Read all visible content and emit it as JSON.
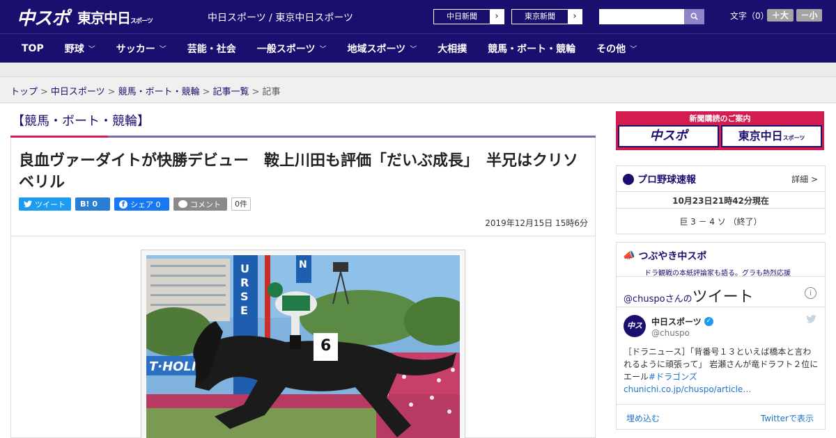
{
  "header": {
    "logo_main": "中スポ",
    "logo_tokyo": "東京中日",
    "logo_tokyo_small": "スポーツ",
    "site_title": "中日スポーツ / 東京中日スポーツ",
    "ext_links": [
      {
        "label": "中日新聞"
      },
      {
        "label": "東京新聞"
      }
    ],
    "font_label": "文字（0）",
    "font_up": "＋大",
    "font_down": "－小"
  },
  "nav": {
    "items": [
      {
        "label": "TOP",
        "chevron": false
      },
      {
        "label": "野球",
        "chevron": true
      },
      {
        "label": "サッカー",
        "chevron": true
      },
      {
        "label": "芸能・社会",
        "chevron": false
      },
      {
        "label": "一般スポーツ",
        "chevron": true
      },
      {
        "label": "地域スポーツ",
        "chevron": true
      },
      {
        "label": "大相撲",
        "chevron": false
      },
      {
        "label": "競馬・ボート・競輪",
        "chevron": false
      },
      {
        "label": "その他",
        "chevron": true
      }
    ]
  },
  "breadcrumb": {
    "items": [
      "トップ",
      "中日スポーツ",
      "競馬・ボート・競輪",
      "記事一覧"
    ],
    "current": "記事"
  },
  "article": {
    "section": "【競馬・ボート・競輪】",
    "headline": "良血ヴァーダイトが快勝デビュー　鞍上川田も評価「だいぶ成長」　半兄はクリソベリル",
    "share": {
      "tweet": "ツイート",
      "hatena": "0",
      "facebook": "シェア 0",
      "comment": "コメント",
      "comment_count": "0件"
    },
    "date": "2019年12月15日 15時6分"
  },
  "sidebar": {
    "subscribe": {
      "head": "新聞購読のご案内",
      "logo_a": "中スポ",
      "logo_b": "東京中日",
      "logo_b_small": "スポーツ"
    },
    "baseball": {
      "title": "プロ野球速報",
      "detail": "詳細 >",
      "timestamp": "10月23日21時42分現在",
      "score": "巨 3 － 4 ソ （終了）"
    },
    "tweets": {
      "title": "つぶやき中スポ",
      "subtitle": "ドラ観戦の本紙評論家も語る。グラも熱烈応援",
      "user_prefix": "@chuspoさんの",
      "user_suffix": "ツイート",
      "name": "中日スポーツ",
      "handle": "@chuspo",
      "avatar_text": "中スポ",
      "text_main": "［ドラニュース］「背番号１３といえば橋本と言われるように頑張って」 岩瀬さんが竜ドラフト２位にエール",
      "text_tag": "#ドラゴンズchunichi.co.jp/chuspo/article…",
      "embed": "埋め込む",
      "view": "Twitterで表示"
    }
  }
}
